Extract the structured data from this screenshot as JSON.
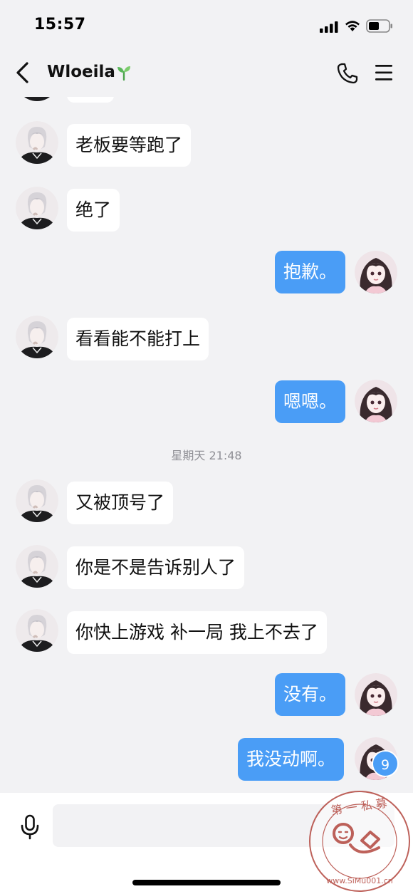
{
  "status": {
    "time": "15:57"
  },
  "nav": {
    "title": "Wloeila"
  },
  "messages": [
    {
      "dir": "in",
      "text": "老板要等跑了"
    },
    {
      "dir": "in",
      "text": "绝了"
    },
    {
      "dir": "out",
      "text": "抱歉。"
    },
    {
      "dir": "in",
      "text": "看看能不能打上"
    },
    {
      "dir": "out",
      "text": "嗯嗯。"
    },
    {
      "dir": "in",
      "text": "又被顶号了"
    },
    {
      "dir": "in",
      "text": "你是不是告诉别人了"
    },
    {
      "dir": "in",
      "text": "你快上游戏 补一局 我上不去了"
    },
    {
      "dir": "out",
      "text": "没有。"
    },
    {
      "dir": "out",
      "text": "我没动啊。"
    }
  ],
  "timestamp": "星期天 21:48",
  "unread_badge": "9",
  "watermark": {
    "top_text": "第 一 私 募",
    "bottom_text": "www.SiMu001.cn"
  },
  "colors": {
    "accent": "#4a9df6",
    "background": "#f2f2f4",
    "incoming": "#ffffff"
  }
}
